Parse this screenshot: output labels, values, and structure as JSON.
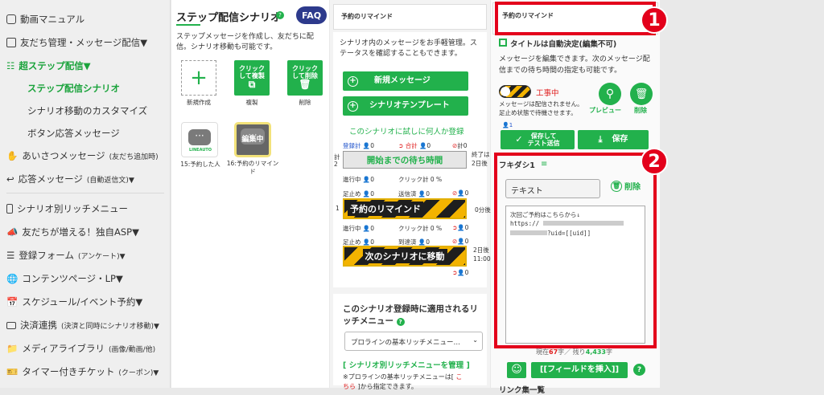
{
  "sidebar": {
    "item0": "動画マニュアル",
    "item1": "友だち管理・メッセージ配信▼",
    "item2": "超ステップ配信▼",
    "item3": "ステップ配信シナリオ",
    "item4": "シナリオ移動のカスタマイズ",
    "item5": "ボタン応答メッセージ",
    "item6": "あいさつメッセージ",
    "item6s": "(友だち追加時)",
    "item7": "応答メッセージ",
    "item7s": "(自動返信文)▼",
    "item8": "シナリオ別リッチメニュー",
    "item9": "友だちが増える！独自ASP▼",
    "item10": "登録フォーム",
    "item10s": "(アンケート)▼",
    "item11": "コンテンツページ・LP▼",
    "item12": "スケジュール/イベント予約▼",
    "item13": "決済連携",
    "item13s": "(決済と同時にシナリオ移動)▼",
    "item14": "メディアライブラリ",
    "item14s": "(画像/動画/他)",
    "item15": "タイマー付きチケット",
    "item15s": "(クーポン)▼"
  },
  "col1": {
    "title": "ステップ配信シナリオ",
    "faq": "FAQ",
    "desc": "ステップメッセージを作成し、友だちに配信。シナリオ移動も可能です。",
    "new_label": "新規作成",
    "copy_btn": "クリック\nして複製",
    "copy_label": "複製",
    "del_btn": "クリック\nして削除",
    "del_label": "削除",
    "card1_logo": "LINEAUTO",
    "card1_label": "15:予約した人",
    "card2_overlay": "編集中",
    "card2_label": "16:予約のリマインド"
  },
  "col2": {
    "header": "予約のリマインド",
    "desc": "シナリオ内のメッセージをお手軽管理。ステータスを確認することもできます。",
    "btn_new": "新規メッセージ",
    "btn_tpl": "シナリオテンプレート",
    "trial": "このシナリオに試しに何人か登録",
    "s_reg": "登録計",
    "s_sum": "合計",
    "s_stop": "計",
    "zero": "0",
    "side_left": "計\n2",
    "side_end": "終了は\n2日後",
    "wait": "開始までの待ち時間",
    "running": "進行中",
    "click": "クリック計",
    "pct": "0 %",
    "stop": "足止め",
    "sent": "送信済",
    "arrived": "到達済",
    "remind": "予約のリマインド",
    "d0": "0分後",
    "num1": "1",
    "move": "次のシナリオに移動",
    "d2": "2日後\n11:00",
    "rich_title": "このシナリオ登録時に適用されるリッチメニュー",
    "rich_sel": "プロラインの基本リッチメニュー…",
    "rich_link": "[ シナリオ別リッチメニューを管理 ]",
    "rich_note1": "※プロラインの基本リッチメニューは[ ",
    "rich_note1_link": "こ",
    "rich_note2_link": "ちら",
    "rich_note2": " ]から指定できます。"
  },
  "col3": {
    "header": "予約のリマインド",
    "auto_title": "タイトルは自動決定(編集不可)",
    "desc": "メッセージを編集できます。次のメッセージ配信までの待ち時間の指定も可能です。",
    "status": "工事中",
    "preview": "プレビュー",
    "delete": "削除",
    "note": "メッセージは配信されません。足止め状態で待機させます。",
    "user_count": "1",
    "save_test": "保存して\nテスト送信",
    "save": "保存",
    "bubble": "フキダシ1",
    "type_sel": "テキスト",
    "bubble_delete": "削除",
    "msg_line1": "次回ご予約はこちらから↓",
    "msg_line2": "https://",
    "msg_line3": "?uid=[[uid]]",
    "count_prefix": "現在",
    "count_now": "67",
    "count_mid": "字／ 残り",
    "count_left": "4,433",
    "count_suffix": "字",
    "insert_field": "[[フィールドを挿入]]",
    "link_label": "リンク集一覧"
  },
  "badges": {
    "one": "1",
    "two": "2"
  },
  "colors": {
    "accent": "#22b14c",
    "red": "#e3001b",
    "navy": "#2d3a8c",
    "hazard": "#f3b300"
  }
}
